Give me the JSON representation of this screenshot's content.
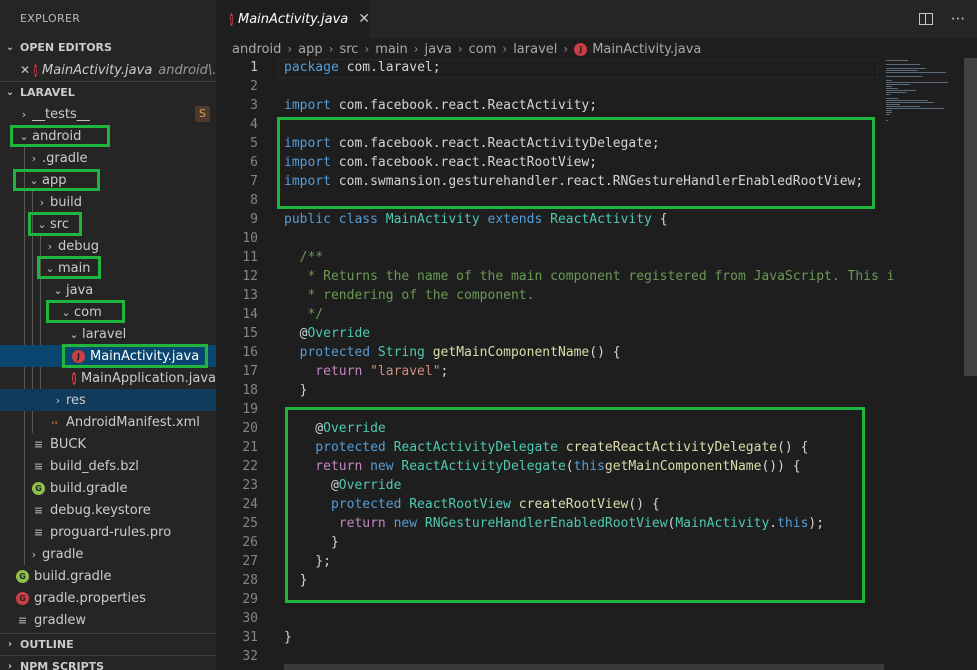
{
  "sidebar": {
    "title": "EXPLORER",
    "open_editors": {
      "header": "OPEN EDITORS",
      "items": [
        {
          "name": "MainActivity.java",
          "path": "android\\..."
        }
      ]
    },
    "project": {
      "header": "LARAVEL",
      "tree": [
        {
          "label": "__tests__",
          "chevron": "›",
          "badge": "S"
        },
        {
          "label": "android",
          "chevron": "⌄"
        },
        {
          "label": ".gradle",
          "chevron": "›"
        },
        {
          "label": "app",
          "chevron": "⌄"
        },
        {
          "label": "build",
          "chevron": "›"
        },
        {
          "label": "src",
          "chevron": "⌄"
        },
        {
          "label": "debug",
          "chevron": "›"
        },
        {
          "label": "main",
          "chevron": "⌄"
        },
        {
          "label": "java",
          "chevron": "⌄"
        },
        {
          "label": "com",
          "chevron": "⌄"
        },
        {
          "label": "laravel",
          "chevron": "⌄"
        },
        {
          "label": "MainActivity.java",
          "icon": "java"
        },
        {
          "label": "MainApplication.java",
          "icon": "java"
        },
        {
          "label": "res",
          "chevron": "›"
        },
        {
          "label": "AndroidManifest.xml",
          "icon": "xml"
        },
        {
          "label": "BUCK",
          "icon": "file"
        },
        {
          "label": "build_defs.bzl",
          "icon": "file"
        },
        {
          "label": "build.gradle",
          "icon": "gradle"
        },
        {
          "label": "debug.keystore",
          "icon": "file"
        },
        {
          "label": "proguard-rules.pro",
          "icon": "file"
        },
        {
          "label": "gradle",
          "chevron": "›"
        },
        {
          "label": "build.gradle",
          "icon": "gradle"
        },
        {
          "label": "gradle.properties",
          "icon": "gradle-red"
        },
        {
          "label": "gradlew",
          "icon": "file"
        }
      ]
    },
    "outline_header": "OUTLINE",
    "npm_header": "NPM SCRIPTS"
  },
  "editor": {
    "tab": {
      "label": "MainActivity.java",
      "close": "✕"
    },
    "actions": {
      "more": "···"
    },
    "breadcrumb": [
      "android",
      "app",
      "src",
      "main",
      "java",
      "com",
      "laravel",
      "MainActivity.java"
    ],
    "line_numbers": [
      "1",
      "2",
      "3",
      "4",
      "5",
      "6",
      "7",
      "8",
      "9",
      "10",
      "11",
      "12",
      "13",
      "14",
      "15",
      "16",
      "17",
      "18",
      "19",
      "20",
      "21",
      "22",
      "23",
      "24",
      "25",
      "26",
      "27",
      "28",
      "29",
      "30",
      "31",
      "32"
    ]
  },
  "colors": {
    "highlight_box": "#1fb53f",
    "keyword": "#569cd6",
    "type": "#4ec9b0",
    "function": "#dcdcaa",
    "string": "#ce9178",
    "comment": "#6a9955"
  }
}
